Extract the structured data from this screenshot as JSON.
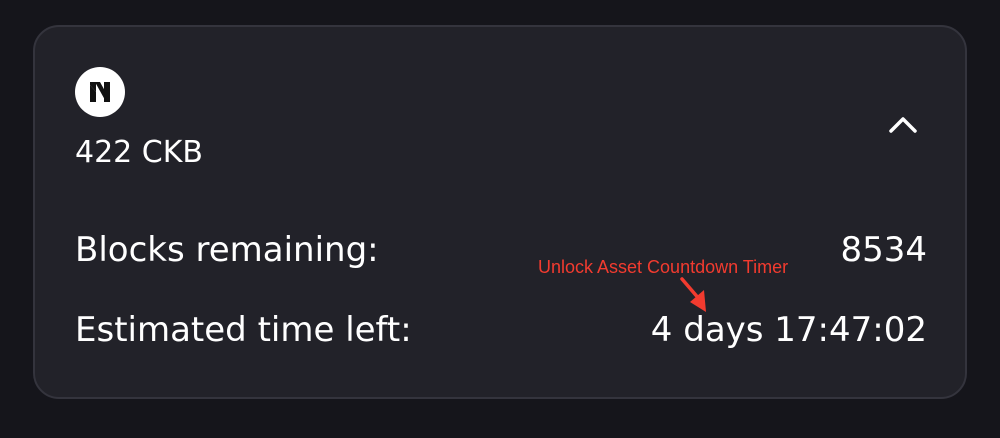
{
  "asset": {
    "logo_icon": "nervos-logo-icon",
    "amount": "422 CKB"
  },
  "controls": {
    "collapse_icon": "chevron-up-icon"
  },
  "details": {
    "blocks_remaining_label": "Blocks remaining:",
    "blocks_remaining_value": "8534",
    "time_left_label": "Estimated time left:",
    "time_left_value": "4 days 17:47:02"
  },
  "annotation": {
    "text": "Unlock Asset Countdown Timer",
    "color": "#f23b2f"
  },
  "colors": {
    "background": "#15151b",
    "card": "#222229",
    "card_border": "#34343d",
    "text": "#ffffff"
  }
}
